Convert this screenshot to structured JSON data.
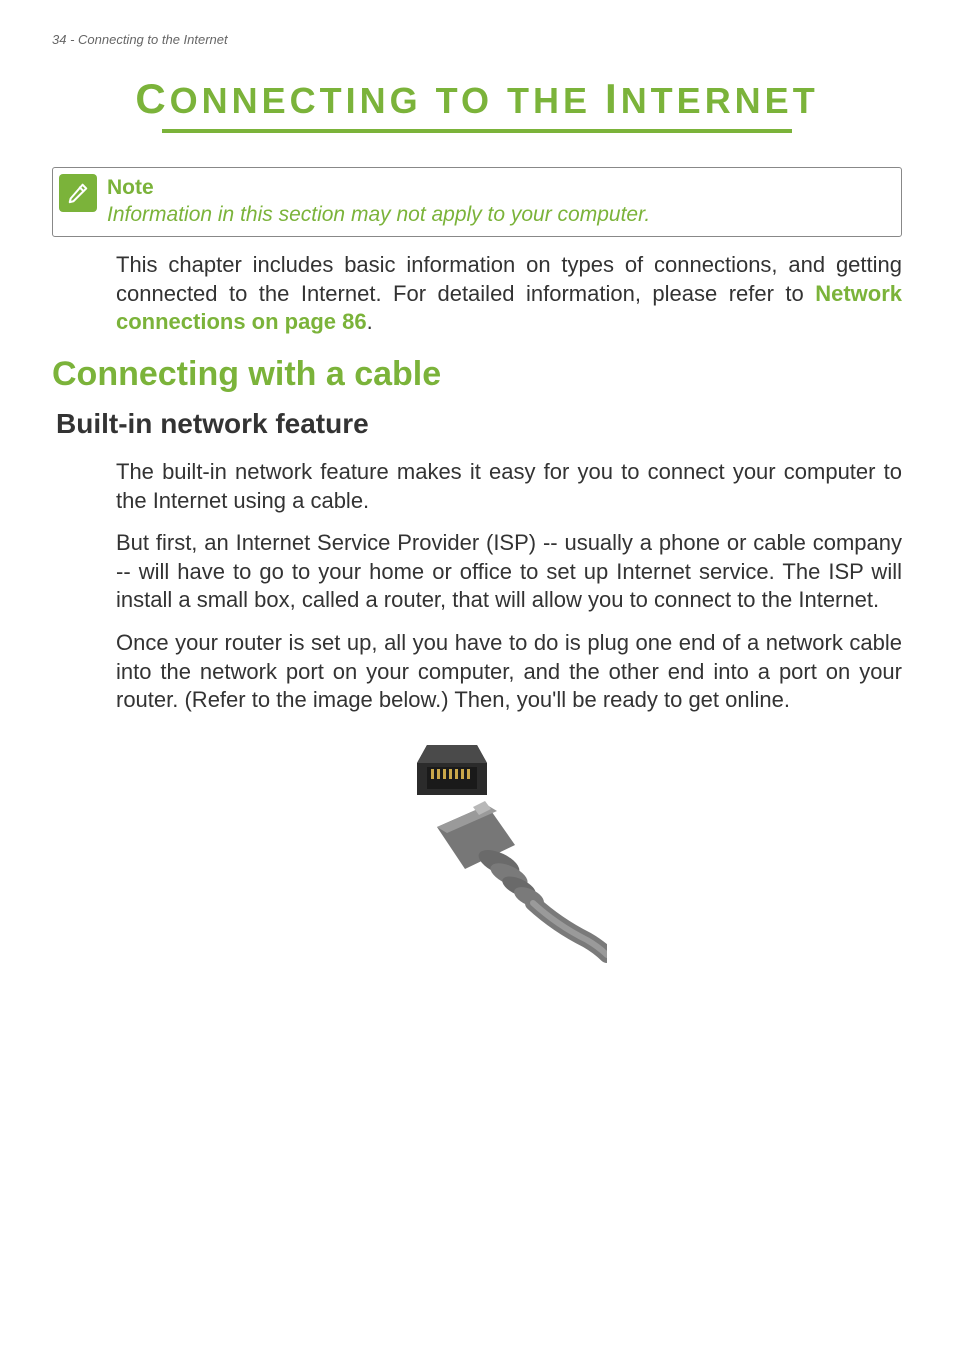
{
  "header": {
    "running": "34 - Connecting to the Internet"
  },
  "chapter": {
    "title_html": "<span class='big'>C</span>ONNECTING TO THE <span class='big'>I</span>NTERNET"
  },
  "note": {
    "label": "Note",
    "text": "Information in this section may not apply to your computer."
  },
  "intro": {
    "text_before_link": "This chapter includes basic information on types of connections, and getting connected to the Internet. For detailed information, please refer to ",
    "link": "Network connections on page 86",
    "text_after_link": "."
  },
  "sections": {
    "h1": "Connecting with a cable",
    "h2": "Built-in network feature",
    "p1": "The built-in network feature makes it easy for you to connect your computer to the Internet using a cable.",
    "p2": "But first, an Internet Service Provider (ISP) -- usually a phone or cable company -- will have to go to your home or office to set up Internet service. The ISP will install a small box, called a router, that will allow you to connect to the Internet.",
    "p3": "Once your router is set up, all you have to do is plug one end of a network cable into the network port on your computer, and the other end into a port on your router. (Refer to the image below.) Then, you'll be ready to get online."
  }
}
